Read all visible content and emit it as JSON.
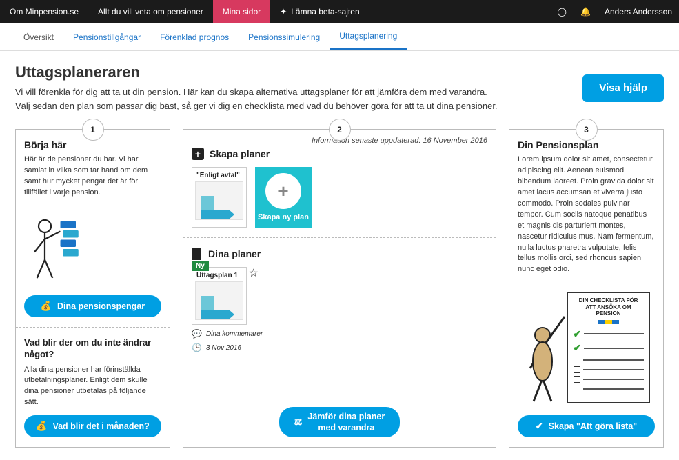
{
  "topnav": {
    "items": [
      {
        "label": "Om Minpension.se"
      },
      {
        "label": "Allt du vill veta om pensioner"
      },
      {
        "label": "Mina sidor"
      },
      {
        "label": "Lämna beta-sajten"
      }
    ],
    "user_name": "Anders Andersson"
  },
  "subnav": {
    "tabs": [
      {
        "label": "Översikt"
      },
      {
        "label": "Pensionstillgångar"
      },
      {
        "label": "Förenklad prognos"
      },
      {
        "label": "Pensionssimulering"
      },
      {
        "label": "Uttagsplanering"
      }
    ]
  },
  "header": {
    "title": "Uttagsplaneraren",
    "desc_line1": "Vi vill förenkla för dig att ta ut din pension. Här kan du skapa alternativa uttagsplaner för att jämföra dem med varandra.",
    "desc_line2": "Välj sedan den plan som passar dig bäst, så ger vi dig en checklista med vad du behöver göra för att ta ut dina pensioner.",
    "help_button": "Visa hjälp"
  },
  "steps": {
    "one": "1",
    "two": "2",
    "three": "3"
  },
  "col1": {
    "section1_title": "Börja här",
    "section1_text": "Här är de pensioner du har. Vi har samlat in vilka som tar hand om dem samt hur mycket pengar det är för tillfället i varje pension.",
    "btn1": "Dina pensionspengar",
    "section2_title": "Vad blir der om du inte ändrar något?",
    "section2_text": "Alla dina pensioner har förinställda utbetalningsplaner. Enligt dem skulle dina pensioner utbetalas på följande sätt.",
    "btn2": "Vad blir det i månaden?"
  },
  "col2": {
    "updated_note": "Information senaste uppdaterad: 16 November 2016",
    "create_header": "Skapa planer",
    "tile_template": "\"Enligt avtal\"",
    "new_plan_label": "Skapa ny plan",
    "your_plans_header": "Dina planer",
    "ny_badge": "Ny",
    "user_plan_name": "Uttagsplan 1",
    "comments_meta": "Dina kommentarer",
    "date_meta": "3 Nov 2016",
    "compare_line1": "Jämför dina planer",
    "compare_line2": "med varandra"
  },
  "col3": {
    "title": "Din Pensionsplan",
    "text": "Lorem ipsum dolor sit amet, consectetur adipiscing elit. Aenean euismod bibendum laoreet. Proin gravida dolor sit amet lacus accumsan et viverra justo commodo. Proin sodales pulvinar tempor. Cum sociis natoque penatibus et magnis dis parturient montes, nascetur ridiculus mus. Nam fermentum, nulla luctus pharetra vulputate, felis tellus mollis orci, sed rhoncus sapien nunc eget odio.",
    "checklist_title": "DIN CHECKLISTA FÖR ATT ANSÖKA OM PENSION",
    "action_btn": "Skapa \"Att göra lista\""
  }
}
